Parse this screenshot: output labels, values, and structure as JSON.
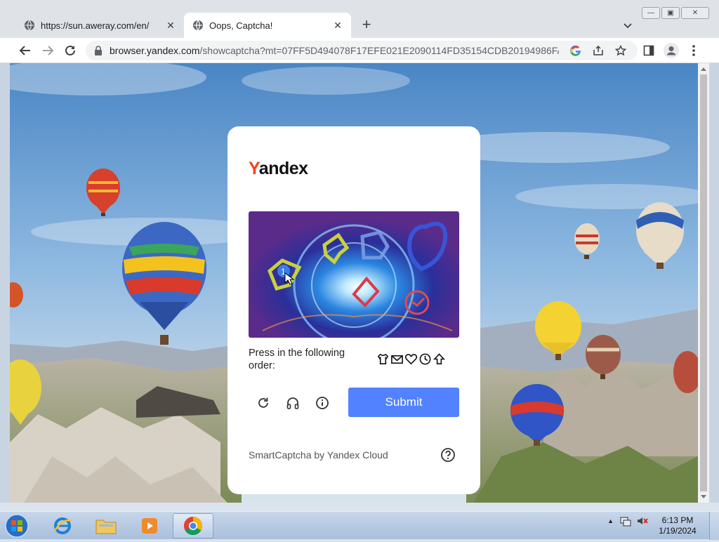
{
  "browser": {
    "tabs": [
      {
        "title": "https://sun.aweray.com/en/",
        "active": false
      },
      {
        "title": "Oops, Captcha!",
        "active": true
      }
    ],
    "url_domain": "browser.yandex.com",
    "url_path": "/showcaptcha?mt=07FF5D494078F17EFE021E2090114FD35154CDB20194986FA1A..."
  },
  "captcha": {
    "logo_first": "Y",
    "logo_rest": "andex",
    "instruction": "Press in the following order:",
    "order_icons": [
      "shirt-icon",
      "envelope-icon",
      "heart-icon",
      "clock-icon",
      "arrow-up-icon"
    ],
    "clicked_marker": "1",
    "submit_label": "Submit",
    "footer": "SmartCaptcha by Yandex Cloud"
  },
  "taskbar": {
    "time": "6:13 PM",
    "date": "1/19/2024"
  },
  "colors": {
    "submit": "#5282ff",
    "logo_accent": "#fc3f1d"
  }
}
